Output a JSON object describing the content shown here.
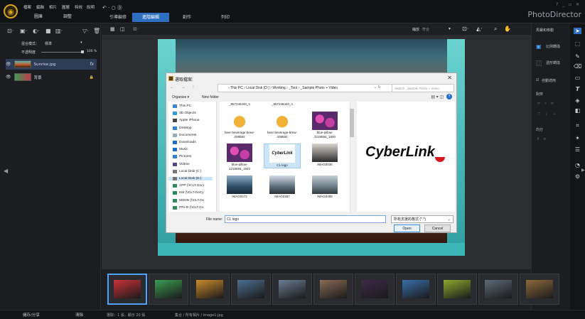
{
  "app": {
    "title": "PhotoDirector",
    "window_controls": "? _ ▫ ✕"
  },
  "menu": [
    "檔案",
    "編輯",
    "相片",
    "圖層",
    "特效",
    "說明"
  ],
  "modes": [
    "圖庫",
    "調整"
  ],
  "tabs": [
    {
      "label": "引導編修",
      "active": false
    },
    {
      "label": "進階編輯",
      "active": true
    },
    {
      "label": "創作",
      "active": false
    },
    {
      "label": "列印",
      "active": false
    }
  ],
  "layers": {
    "blend_label": "混合模式：",
    "blend_value": "標準",
    "opacity_label": "不透明度",
    "opacity_value": "100 %",
    "items": [
      {
        "name": "Sunrise.jpg",
        "badge": "fx",
        "selected": true
      },
      {
        "name": "背景",
        "badge": "🔒",
        "selected": false
      }
    ]
  },
  "canvas_toolbar": {
    "zoom_label": "縮放",
    "zoom_value": "符合"
  },
  "dialog": {
    "title": "選取檔案:",
    "address": "› This PC › Local Disk (D:) › Working › _Tool › _Sample Photo + Video",
    "search_placeholder": "Search _Sample Photo + Video",
    "organize": "Organize ▾",
    "new_folder": "New folder",
    "nav_items": [
      {
        "label": "This PC",
        "color": "#3b86d8",
        "selected": false
      },
      {
        "label": "3D Objects",
        "color": "#2d9fd8",
        "selected": false
      },
      {
        "label": "Apple iPhone",
        "color": "#444",
        "selected": false
      },
      {
        "label": "Desktop",
        "color": "#2f7fd2",
        "selected": false
      },
      {
        "label": "Documents",
        "color": "#9ab",
        "selected": false
      },
      {
        "label": "Downloads",
        "color": "#1b6fc9",
        "selected": false
      },
      {
        "label": "Music",
        "color": "#1b6fc9",
        "selected": false
      },
      {
        "label": "Pictures",
        "color": "#2f7fd2",
        "selected": false
      },
      {
        "label": "Videos",
        "color": "#4a4a8a",
        "selected": false
      },
      {
        "label": "Local Disk (C:)",
        "color": "#777",
        "selected": false
      },
      {
        "label": "Local Disk (D:)",
        "color": "#777",
        "selected": true
      },
      {
        "label": "APP (\\\\CLT.Goc)",
        "color": "#2e8b57",
        "selected": false
      },
      {
        "label": "KM (\\\\CLT.GoCy",
        "color": "#2e8b57",
        "selected": false
      },
      {
        "label": "MSDN (\\\\CLT.Gc",
        "color": "#2e8b57",
        "selected": false
      },
      {
        "label": "PRI-D (\\\\CLT.Go",
        "color": "#2e8b57",
        "selected": false
      }
    ],
    "files_top_cut": [
      "_857246440_n",
      "_857246440_n"
    ],
    "files": [
      {
        "label": "beer-beverage-brew-209582",
        "kind": "beer",
        "selected": false
      },
      {
        "label": "beer-beverage-brew-209582",
        "kind": "beer",
        "selected": false
      },
      {
        "label": "blue-pillow-2219594_1920",
        "kind": "flower",
        "selected": false
      },
      {
        "label": "blue-pillow-2219594_1920",
        "kind": "flower",
        "selected": false
      },
      {
        "label": "CL logo",
        "kind": "cllogo",
        "selected": true
      },
      {
        "label": "IMAG0036",
        "kind": "dark",
        "selected": false
      },
      {
        "label": "IMAG0472",
        "kind": "sky",
        "selected": false
      },
      {
        "label": "IMAG0487",
        "kind": "sky2",
        "selected": false
      },
      {
        "label": "IMAG0488",
        "kind": "sky3",
        "selected": false
      }
    ],
    "preview_text": "CyberLink",
    "filename_label": "File name:",
    "filename_value": "CL logo",
    "filter_value": "所有支援的格式 (*.*)",
    "open_label": "Open",
    "cancel_label": "Cancel"
  },
  "right_panel": {
    "header": "馬賽和移動",
    "ratio_label": "比例轉換",
    "transform_label": "透形轉換",
    "auto_label": "自動適用",
    "align_label": "對齊",
    "distribute_label": "均分"
  },
  "filmstrip": {
    "colors": [
      "#c9323a",
      "#3c9d53",
      "#c98a2e",
      "#4d6f8f",
      "#6a7d92",
      "#8a6b55",
      "#3e2a4a",
      "#3a6ea8",
      "#8ea832",
      "#5d6a77",
      "#8c6a3e"
    ]
  },
  "status": {
    "share_label": "儲存/分享",
    "clear_label": "清除",
    "selection_text": "選取：1 張，顯示 20 張",
    "path_text": "集合 / 所有相片 / image1.jpg"
  }
}
